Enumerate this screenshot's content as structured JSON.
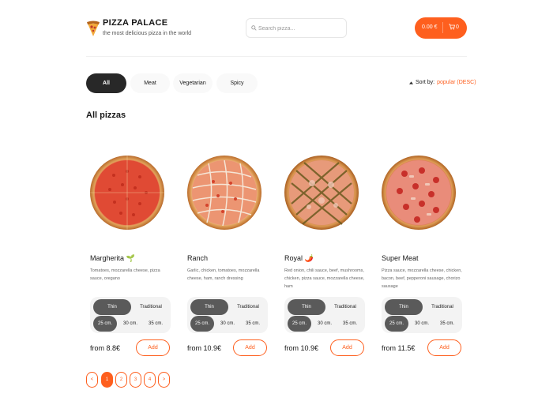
{
  "header": {
    "brand": "PIZZA PALACE",
    "tagline": "the most delicious pizza in the world",
    "search_placeholder": "Search pizza...",
    "cart_price": "0.00 €",
    "cart_count": "0"
  },
  "categories": [
    "All",
    "Meat",
    "Vegetarian",
    "Spicy"
  ],
  "active_category": "All",
  "sort": {
    "label": "Sort by:",
    "value": "popular (DESC)"
  },
  "section_title": "All pizzas",
  "pizzas": [
    {
      "name": "Margherita",
      "badge": "🌱",
      "description": "Tomatoes, mozzarella cheese, pizza sauce, oregano",
      "dough": [
        "Thin",
        "Traditional"
      ],
      "sizes": [
        "25 cm.",
        "30 cm.",
        "35 cm."
      ],
      "price": "from 8.8€",
      "add_label": "Add"
    },
    {
      "name": "Ranch",
      "badge": "",
      "description": "Garlic, chicken, tomatoes, mozzarella cheese, ham, ranch dressing",
      "dough": [
        "Thin",
        "Traditional"
      ],
      "sizes": [
        "25 cm.",
        "30 cm.",
        "35 cm."
      ],
      "price": "from 10.9€",
      "add_label": "Add"
    },
    {
      "name": "Royal",
      "badge": "🌶️",
      "description": "Red onion, chili sauce, beef, mushrooms, chicken, pizza sauce, mozzarella cheese, ham",
      "dough": [
        "Thin",
        "Traditional"
      ],
      "sizes": [
        "25 cm.",
        "30 cm.",
        "35 cm."
      ],
      "price": "from 10.9€",
      "add_label": "Add"
    },
    {
      "name": "Super Meat",
      "badge": "",
      "description": "Pizza sauce, mozzarella cheese, chicken, bacon, beef, pepperoni sausage, chorizo sausage",
      "dough": [
        "Thin",
        "Traditional"
      ],
      "sizes": [
        "25 cm.",
        "30 cm.",
        "35 cm."
      ],
      "price": "from 11.5€",
      "add_label": "Add"
    }
  ],
  "pagination": {
    "prev": "<",
    "pages": [
      "1",
      "2",
      "3",
      "4"
    ],
    "next": ">",
    "current": "1"
  },
  "colors": {
    "accent": "#fe5f1e",
    "active_chip": "#282828",
    "selected_option": "#5a5a5a"
  }
}
